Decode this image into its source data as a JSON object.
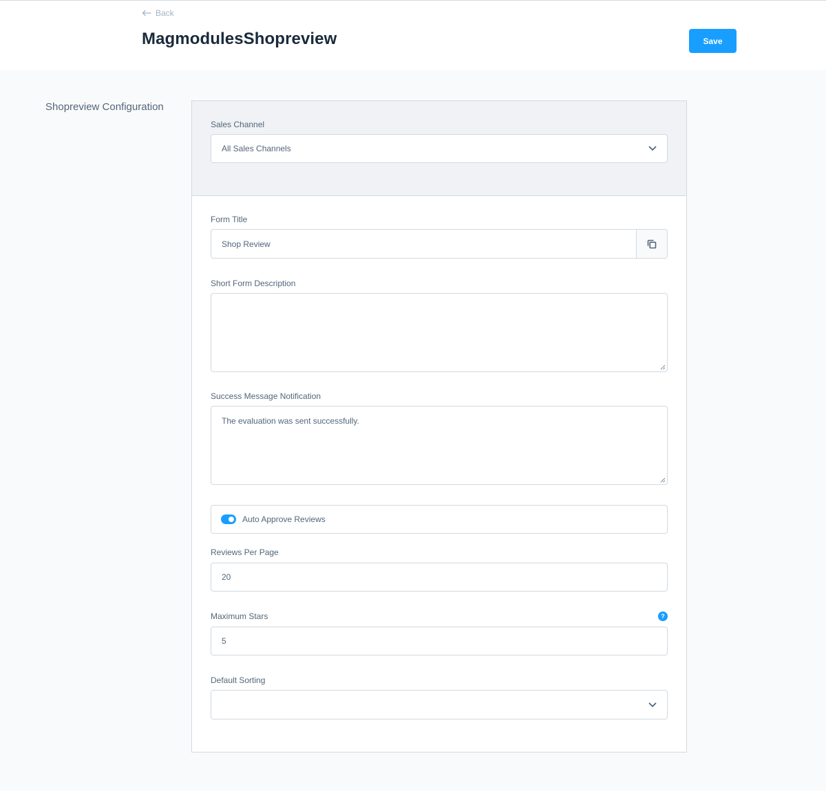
{
  "header": {
    "back_label": "Back",
    "title": "MagmodulesShopreview",
    "save_label": "Save"
  },
  "section": {
    "label": "Shopreview Configuration"
  },
  "form": {
    "sales_channel": {
      "label": "Sales Channel",
      "value": "All Sales Channels"
    },
    "form_title": {
      "label": "Form Title",
      "value": "Shop Review"
    },
    "short_description": {
      "label": "Short Form Description",
      "value": ""
    },
    "success_message": {
      "label": "Success Message Notification",
      "value": "The evaluation was sent successfully."
    },
    "auto_approve": {
      "label": "Auto Approve Reviews",
      "enabled": true
    },
    "reviews_per_page": {
      "label": "Reviews Per Page",
      "value": "20"
    },
    "maximum_stars": {
      "label": "Maximum Stars",
      "value": "5",
      "help_icon": "question-icon",
      "help_glyph": "?"
    },
    "default_sorting": {
      "label": "Default Sorting",
      "value": ""
    }
  },
  "colors": {
    "accent": "#189eff",
    "text": "#52667a",
    "title": "#1a2a3a",
    "border": "#d1d9e0",
    "background": "#f9fafb"
  }
}
